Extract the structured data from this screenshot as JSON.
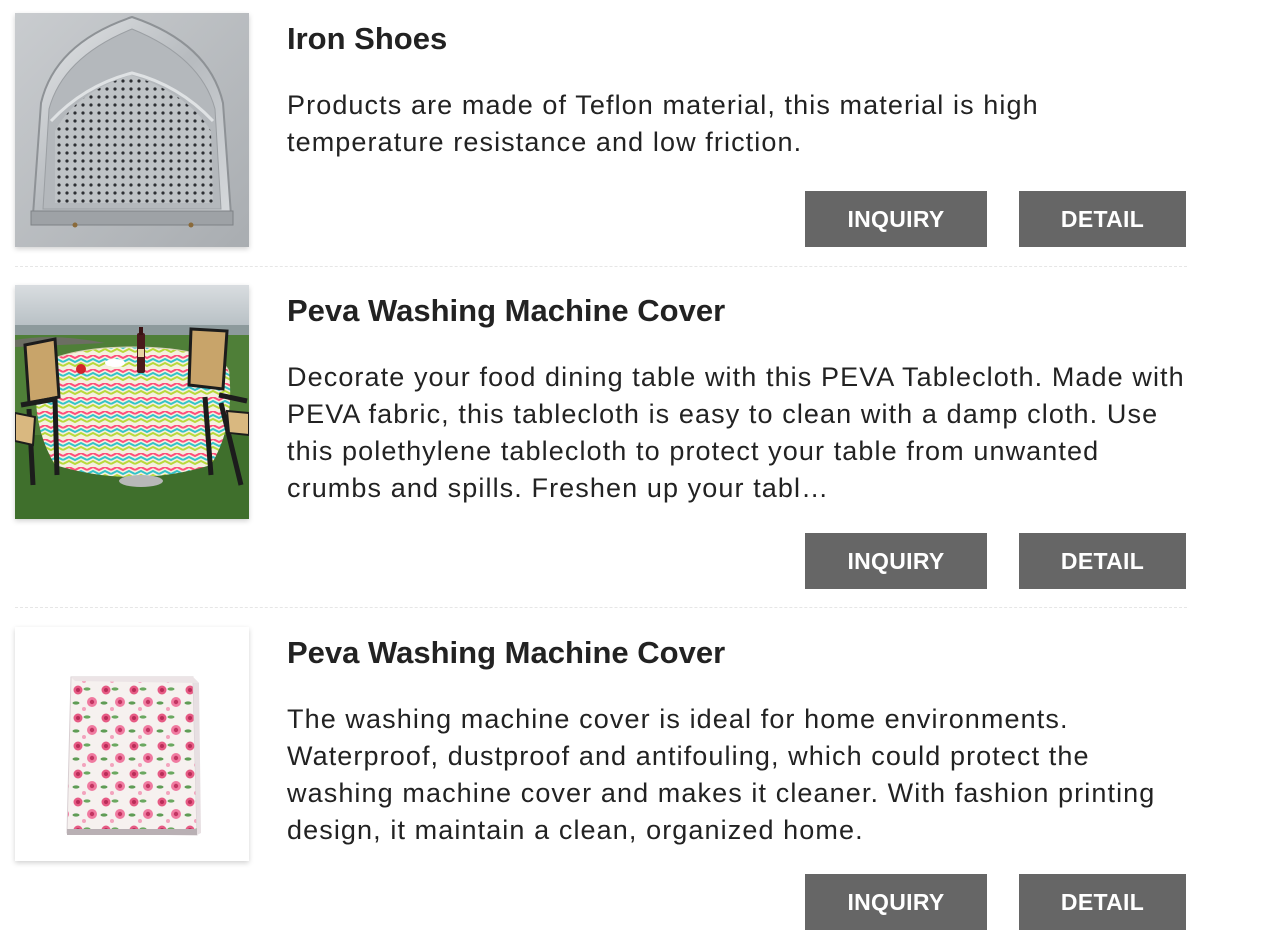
{
  "products": [
    {
      "title": "Iron Shoes",
      "description": "Products are made of Teflon material, this material is high temperature resistance and low friction.",
      "image_icon": "iron-shoe-image",
      "inquiry_label": "INQUIRY",
      "detail_label": "DETAIL"
    },
    {
      "title": "Peva Washing Machine Cover",
      "description": "Decorate your food dining table with this PEVA Tablecloth. Made with PEVA fabric, this tablecloth is easy to clean with a damp cloth. Use this polethylene tablecloth to protect your table from unwanted crumbs and spills. Freshen up your tabl…",
      "image_icon": "tablecloth-image",
      "inquiry_label": "INQUIRY",
      "detail_label": "DETAIL"
    },
    {
      "title": "Peva Washing Machine Cover",
      "description": "The washing machine cover is ideal for home environments. Waterproof, dustproof and antifouling, which could protect the washing machine cover and makes it cleaner. With fashion printing design, it maintain a clean, organized home.",
      "image_icon": "washing-machine-cover-image",
      "inquiry_label": "INQUIRY",
      "detail_label": "DETAIL"
    }
  ],
  "colors": {
    "button_bg": "#666666",
    "button_text": "#ffffff",
    "title_text": "#222222",
    "divider": "#e6e6e6"
  }
}
